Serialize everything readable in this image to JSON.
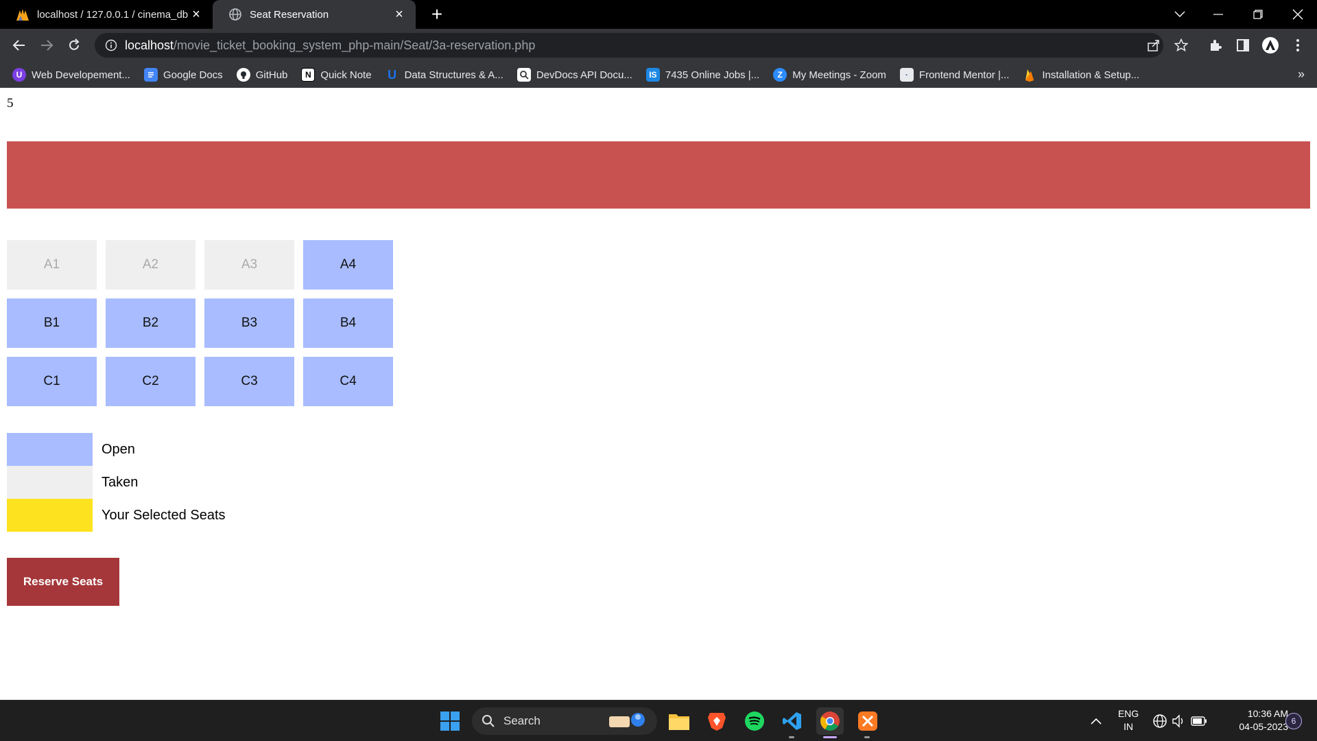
{
  "browser": {
    "tabs": [
      {
        "title": "localhost / 127.0.0.1 / cinema_db",
        "active": false,
        "icon": "phpmyadmin-icon"
      },
      {
        "title": "Seat Reservation",
        "active": true,
        "icon": "globe-icon"
      }
    ],
    "url_host": "localhost",
    "url_path": "/movie_ticket_booking_system_php-main/Seat/3a-reservation.php",
    "bookmarks": [
      {
        "label": "Web Developement...",
        "icon": "u-icon",
        "color": "#7b3fe4"
      },
      {
        "label": "Google Docs",
        "icon": "docs-icon",
        "color": "#4285f4"
      },
      {
        "label": "GitHub",
        "icon": "github-icon",
        "color": "#35363a"
      },
      {
        "label": "Quick Note",
        "icon": "notion-icon",
        "color": "#ffffff"
      },
      {
        "label": "Data Structures & A...",
        "icon": "u-shield-icon",
        "color": "#1a73e8"
      },
      {
        "label": "DevDocs API Docu...",
        "icon": "devdocs-icon",
        "color": "#ffffff"
      },
      {
        "label": "7435 Online Jobs |...",
        "icon": "is-icon",
        "color": "#1e88e5"
      },
      {
        "label": "My Meetings - Zoom",
        "icon": "zoom-icon",
        "color": "#2d8cff"
      },
      {
        "label": "Frontend Mentor |...",
        "icon": "frontend-mentor-icon",
        "color": "#e8eaed"
      },
      {
        "label": "Installation & Setup...",
        "icon": "firebase-icon",
        "color": "#ffca28"
      }
    ],
    "more_bookmarks": "»"
  },
  "page": {
    "selected_count": "5",
    "seats": [
      {
        "label": "A1",
        "status": "taken"
      },
      {
        "label": "A2",
        "status": "taken"
      },
      {
        "label": "A3",
        "status": "taken"
      },
      {
        "label": "A4",
        "status": "open"
      },
      {
        "label": "B1",
        "status": "open"
      },
      {
        "label": "B2",
        "status": "open"
      },
      {
        "label": "B3",
        "status": "open"
      },
      {
        "label": "B4",
        "status": "open"
      },
      {
        "label": "C1",
        "status": "open"
      },
      {
        "label": "C2",
        "status": "open"
      },
      {
        "label": "C3",
        "status": "open"
      },
      {
        "label": "C4",
        "status": "open"
      }
    ],
    "legend": [
      {
        "label": "Open",
        "color": "#a8bcff"
      },
      {
        "label": "Taken",
        "color": "#efefef"
      },
      {
        "label": "Your Selected Seats",
        "color": "#fde21f"
      }
    ],
    "reserve_button": "Reserve Seats",
    "colors": {
      "screen": "#c85250",
      "button": "#a5373a"
    }
  },
  "taskbar": {
    "search_label": "Search",
    "language": "ENG",
    "region": "IN",
    "time": "10:36 AM",
    "date": "04-05-2023",
    "notification_count": "6"
  }
}
